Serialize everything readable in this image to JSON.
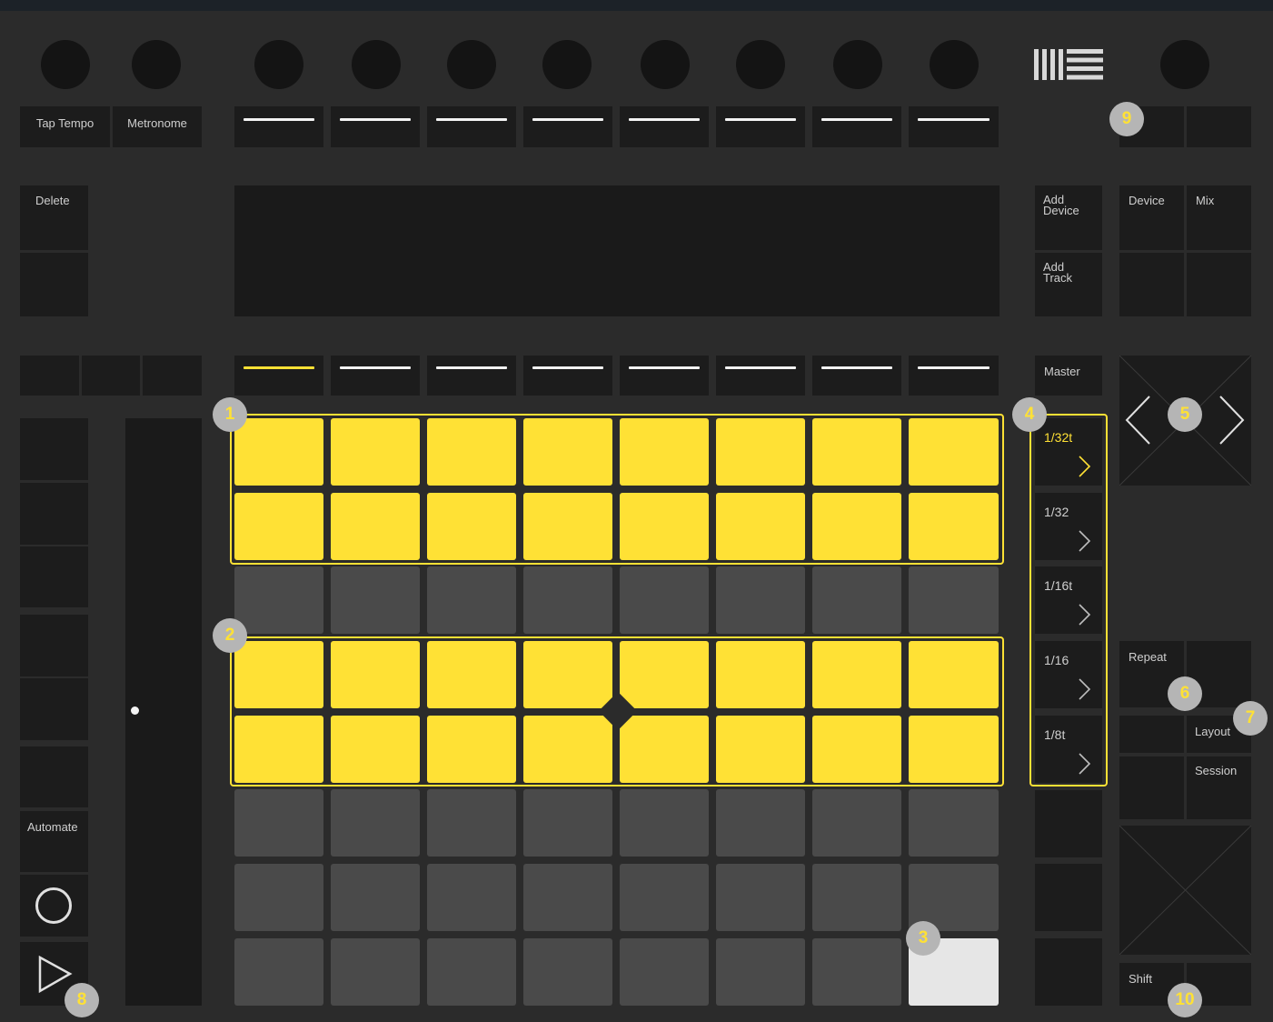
{
  "controller": {
    "tap_tempo": "Tap Tempo",
    "metronome": "Metronome",
    "delete": "Delete",
    "add_device": "Add\nDevice",
    "add_track": "Add\nTrack",
    "device": "Device",
    "mix": "Mix",
    "master": "Master",
    "repeat": "Repeat",
    "layout": "Layout",
    "session": "Session",
    "automate": "Automate",
    "shift": "Shift"
  },
  "repeat_rates": [
    "1/32t",
    "1/32",
    "1/16t",
    "1/16",
    "1/8t"
  ],
  "active_rate_index": 0,
  "selected_track_index": 0,
  "pad_grid": {
    "rows": [
      [
        "on",
        "on",
        "on",
        "on",
        "on",
        "on",
        "on",
        "on"
      ],
      [
        "on",
        "on",
        "on",
        "on",
        "on",
        "on",
        "on",
        "on"
      ],
      [
        "off",
        "off",
        "off",
        "off",
        "off",
        "off",
        "off",
        "off"
      ],
      [
        "on",
        "on",
        "on",
        "on",
        "on",
        "on",
        "on",
        "on"
      ],
      [
        "on",
        "on",
        "on",
        "on",
        "on",
        "on",
        "on",
        "on"
      ],
      [
        "off",
        "off",
        "off",
        "off",
        "off",
        "off",
        "off",
        "off"
      ],
      [
        "off",
        "off",
        "off",
        "off",
        "off",
        "off",
        "off",
        "off"
      ],
      [
        "off",
        "off",
        "off",
        "off",
        "off",
        "off",
        "off",
        "white"
      ]
    ]
  },
  "badges": [
    "1",
    "2",
    "3",
    "4",
    "5",
    "6",
    "7",
    "8",
    "9",
    "10"
  ],
  "icons": {
    "logo": "ableton-logo-icon",
    "record": "record-circle-icon",
    "play": "play-triangle-icon",
    "arrow_left": "chevron-left-icon",
    "arrow_right": "chevron-right-icon"
  },
  "colors": {
    "accent": "#ffe135",
    "pad_off": "#4a4a4a",
    "background": "#2b2b2b",
    "button": "#1c1c1c"
  }
}
